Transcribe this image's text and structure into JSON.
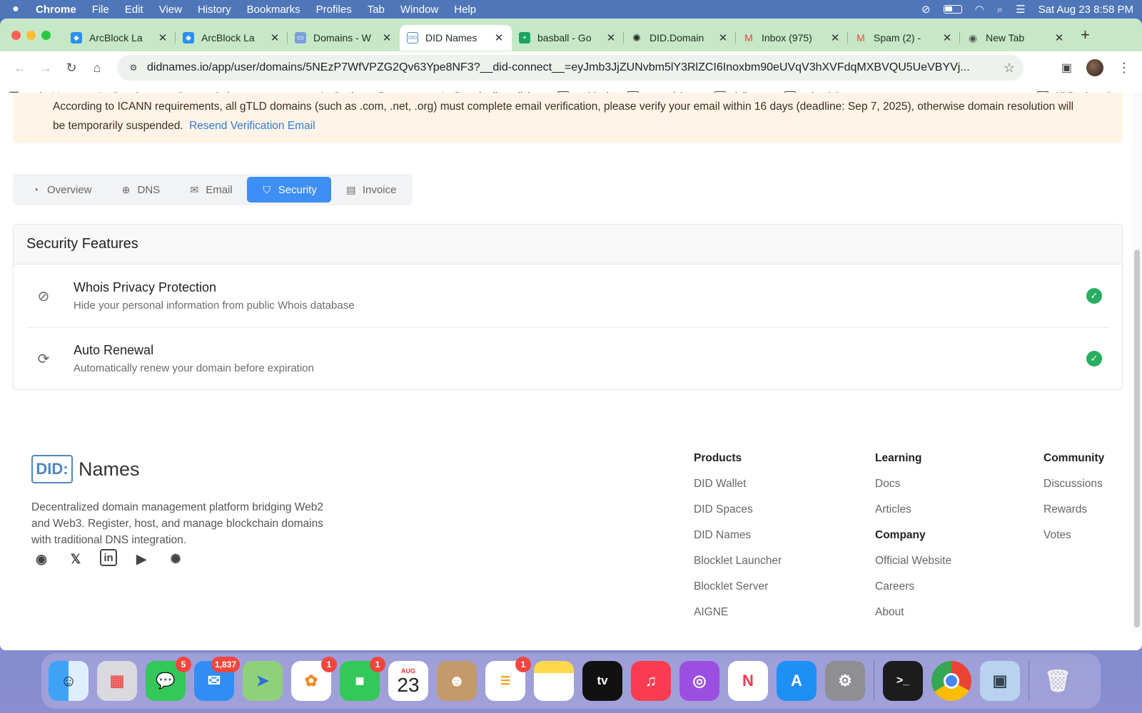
{
  "menubar": {
    "app": "Chrome",
    "items": [
      "File",
      "Edit",
      "View",
      "History",
      "Bookmarks",
      "Profiles",
      "Tab",
      "Window",
      "Help"
    ],
    "datetime": "Sat Aug 23  8:58 PM"
  },
  "tabs": [
    {
      "label": "ArcBlock La",
      "color": "#2b8ef0"
    },
    {
      "label": "ArcBlock La",
      "color": "#2b8ef0"
    },
    {
      "label": "Domains - W",
      "color": "#7aa0d8"
    },
    {
      "label": "DID Names",
      "color": "#4f88c6"
    },
    {
      "label": "basball - Go",
      "color": "#1ea362"
    },
    {
      "label": "DID.Domain",
      "color": "#222222"
    },
    {
      "label": "Inbox (975)",
      "color": "#ea4335"
    },
    {
      "label": "Spam (2) - ",
      "color": "#ea4335"
    },
    {
      "label": "New Tab",
      "color": "#555555"
    }
  ],
  "toolbar": {
    "url": "didnames.io/app/user/domains/5NEzP7WfVPZG2Qv63Ype8NF3?__did-connect__=eyJmb3JjZUNvbm5lY3RlZCI6Inoxbm90eUVqV3hXVFdqMXBVQU5UeVBYVj..."
  },
  "bookmarks": {
    "items": [
      "Home",
      "Google",
      "the mandrake mec...",
      "",
      "Settings - Passwo...",
      "Board editor • lich...",
      "arcblock",
      "crazyvisions",
      "daily arc",
      "schoolology"
    ],
    "all": "All Bookmarks"
  },
  "banner": {
    "text": "According to ICANN requirements, all gTLD domains (such as .com, .net, .org) must complete email verification, please verify your email within 16 days (deadline: Sep 7, 2025), otherwise domain resolution will be temporarily suspended.",
    "link": "Resend Verification Email"
  },
  "page_tabs": [
    "Overview",
    "DNS",
    "Email",
    "Security",
    "Invoice"
  ],
  "security": {
    "title": "Security Features",
    "features": [
      {
        "title": "Whois Privacy Protection",
        "desc": "Hide your personal information from public Whois database",
        "enabled": true
      },
      {
        "title": "Auto Renewal",
        "desc": "Automatically renew your domain before expiration",
        "enabled": true
      }
    ]
  },
  "footer": {
    "logo_did": "DID:",
    "logo_names": "Names",
    "tagline": "Decentralized domain management platform bridging Web2 and Web3. Register, host, and manage blockchain domains with traditional DNS integration.",
    "products": {
      "heading": "Products",
      "links": [
        "DID Wallet",
        "DID Spaces",
        "DID Names",
        "Blocklet Launcher",
        "Blocklet Server",
        "AIGNE"
      ]
    },
    "learning": {
      "heading": "Learning",
      "links": [
        "Docs",
        "Articles"
      ]
    },
    "company": {
      "heading": "Company",
      "links": [
        "Official Website",
        "Careers",
        "About"
      ]
    },
    "community": {
      "heading": "Community",
      "links": [
        "Discussions",
        "Rewards",
        "Votes"
      ]
    }
  },
  "dock": {
    "messages_badge": "5",
    "mail_badge": "1,837",
    "photos_badge": "1",
    "facetime_badge": "1",
    "reminders_badge": "1",
    "calendar_month": "AUG",
    "calendar_day": "23"
  }
}
